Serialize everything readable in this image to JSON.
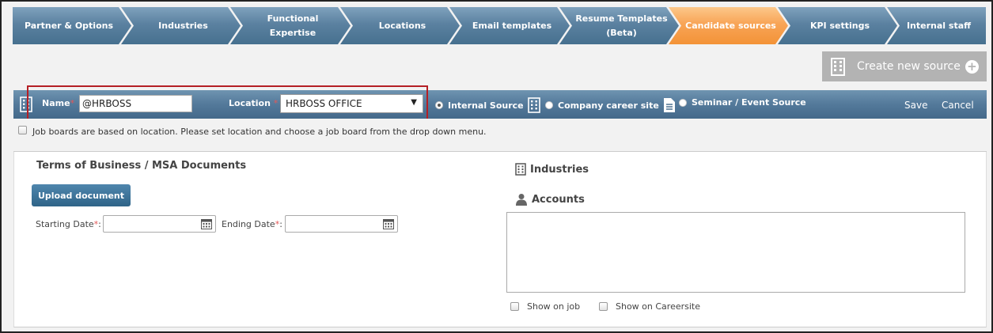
{
  "steps": [
    {
      "label": "Partner & Options"
    },
    {
      "label": "Industries"
    },
    {
      "label": "Functional",
      "label2": "Expertise"
    },
    {
      "label": "Locations"
    },
    {
      "label": "Email templates"
    },
    {
      "label": "Resume Templates",
      "label2": "(Beta)"
    },
    {
      "label": "Candidate sources",
      "active": true
    },
    {
      "label": "KPI settings"
    },
    {
      "label": "Internal staff"
    }
  ],
  "create_button": {
    "label": "Create new source",
    "icon": "building-icon",
    "plus": "+"
  },
  "source_bar": {
    "name_label": "Name",
    "name_required": "*",
    "name_value": "@HRBOSS",
    "location_label": "Location",
    "location_required": "*",
    "location_value": "HRBOSS OFFICE",
    "radios": [
      {
        "label": "Internal Source",
        "icon": "building-icon",
        "selected": true
      },
      {
        "label": "Company career site",
        "icon": "document-icon",
        "selected": false
      },
      {
        "label": "Seminar / Event Source",
        "selected": false
      }
    ],
    "save_label": "Save",
    "cancel_label": "Cancel"
  },
  "note": {
    "text": "Job boards are based on location. Please set location and choose a job board from the drop down menu."
  },
  "terms": {
    "title": "Terms of Business / MSA Documents",
    "upload_label": "Upload document",
    "start_label": "Starting Date",
    "end_label": "Ending Date",
    "required": "*"
  },
  "right": {
    "industries_title": "Industries",
    "accounts_title": "Accounts",
    "show_on_job": "Show on job",
    "show_on_careersite": "Show on Careersite"
  },
  "colors": {
    "accent_active": "#f39337",
    "bar_blue": "#53799a",
    "required_red": "#e35757",
    "highlight_red": "#b51f25"
  }
}
